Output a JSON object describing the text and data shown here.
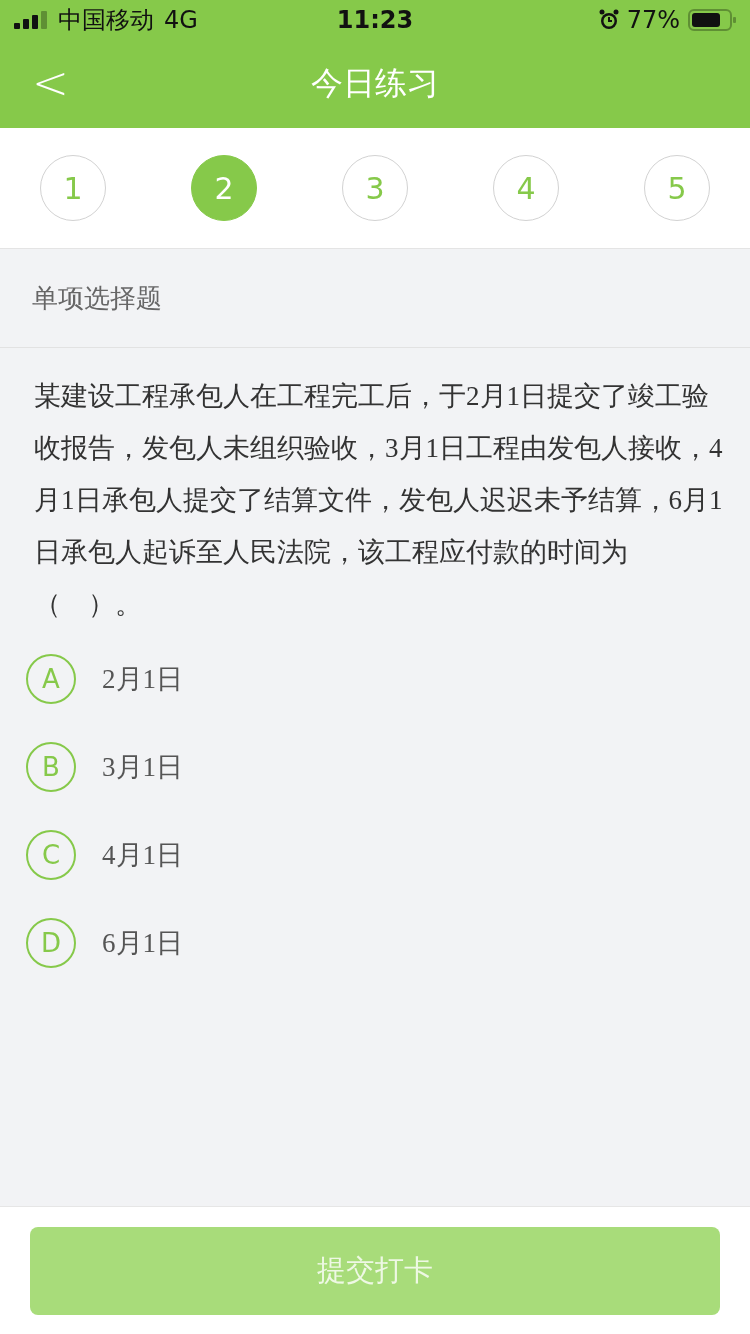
{
  "status_bar": {
    "carrier": "中国移动",
    "network": "4G",
    "time": "11:23",
    "battery": "77%"
  },
  "nav": {
    "back": "<",
    "title": "今日练习"
  },
  "questions": [
    {
      "label": "1",
      "selected": false
    },
    {
      "label": "2",
      "selected": true
    },
    {
      "label": "3",
      "selected": false
    },
    {
      "label": "4",
      "selected": false
    },
    {
      "label": "5",
      "selected": false
    }
  ],
  "section": "单项选择题",
  "question_text": "某建设工程承包人在工程完工后，于2月1日提交了竣工验收报告，发包人未组织验收，3月1日工程由发包人接收，4月1日承包人提交了结算文件，发包人迟迟未予结算，6月1日承包人起诉至人民法院，该工程应付款的时间为（　）。",
  "options": [
    {
      "letter": "A",
      "text": "2月1日",
      "selected": false
    },
    {
      "letter": "B",
      "text": "3月1日",
      "selected": false
    },
    {
      "letter": "C",
      "text": "4月1日",
      "selected": false
    },
    {
      "letter": "D",
      "text": "6月1日",
      "selected": false
    }
  ],
  "submit": {
    "label": "提交打卡",
    "disabled": true
  }
}
